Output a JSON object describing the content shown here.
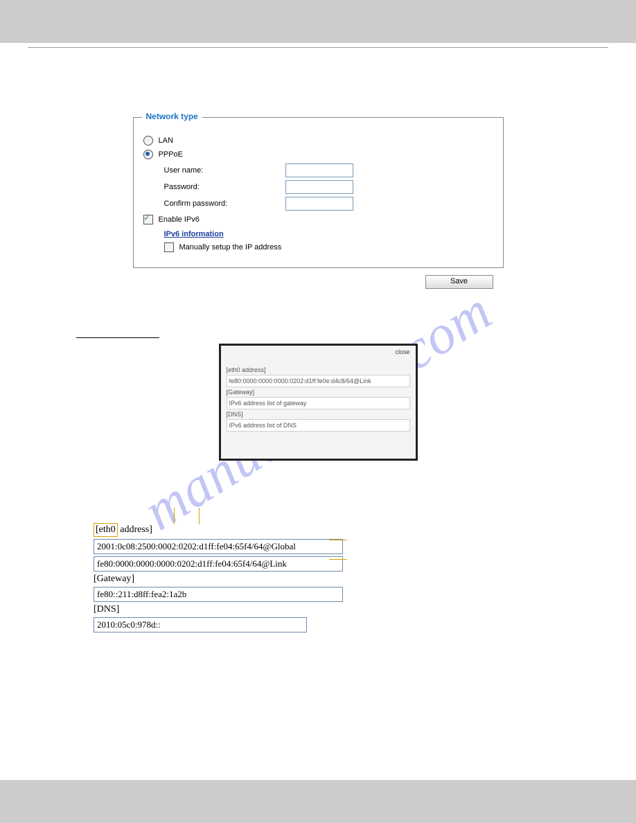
{
  "header_title": "",
  "watermark": "manualshive.com",
  "panel": {
    "legend": "Network type",
    "opt_lan": "LAN",
    "opt_pppoe": "PPPoE",
    "user_name_lbl": "User name:",
    "password_lbl": "Password:",
    "confirm_lbl": "Confirm password:",
    "enable_ipv6": "Enable IPv6",
    "ipv6_info": "IPv6 information",
    "manual_ip": "Manually setup the IP address"
  },
  "save_btn": "Save",
  "popup": {
    "close": "close",
    "eth0_lbl": "[eth0 address]",
    "eth0_val": "fe80:0000:0000:0000:0202:d1ff:fe0e:d4c8/64@Link",
    "gw_lbl": "[Gateway]",
    "gw_val": "IPv6 address list of gateway",
    "dns_lbl": "[DNS]",
    "dns_val": "IPv6 address list of DNS"
  },
  "ip": {
    "eth0_hdr_pre": "[eth0",
    "eth0_hdr_post": " address]",
    "global": "2001:0c08:2500:0002:0202:d1ff:fe04:65f4/64@Global",
    "link": "fe80:0000:0000:0000:0202:d1ff:fe04:65f4/64@Link",
    "gw_hdr": "[Gateway]",
    "gw": "fe80::211:d8ff:fea2:1a2b",
    "dns_hdr": "[DNS]",
    "dns": "2010:05c0:978d::"
  }
}
